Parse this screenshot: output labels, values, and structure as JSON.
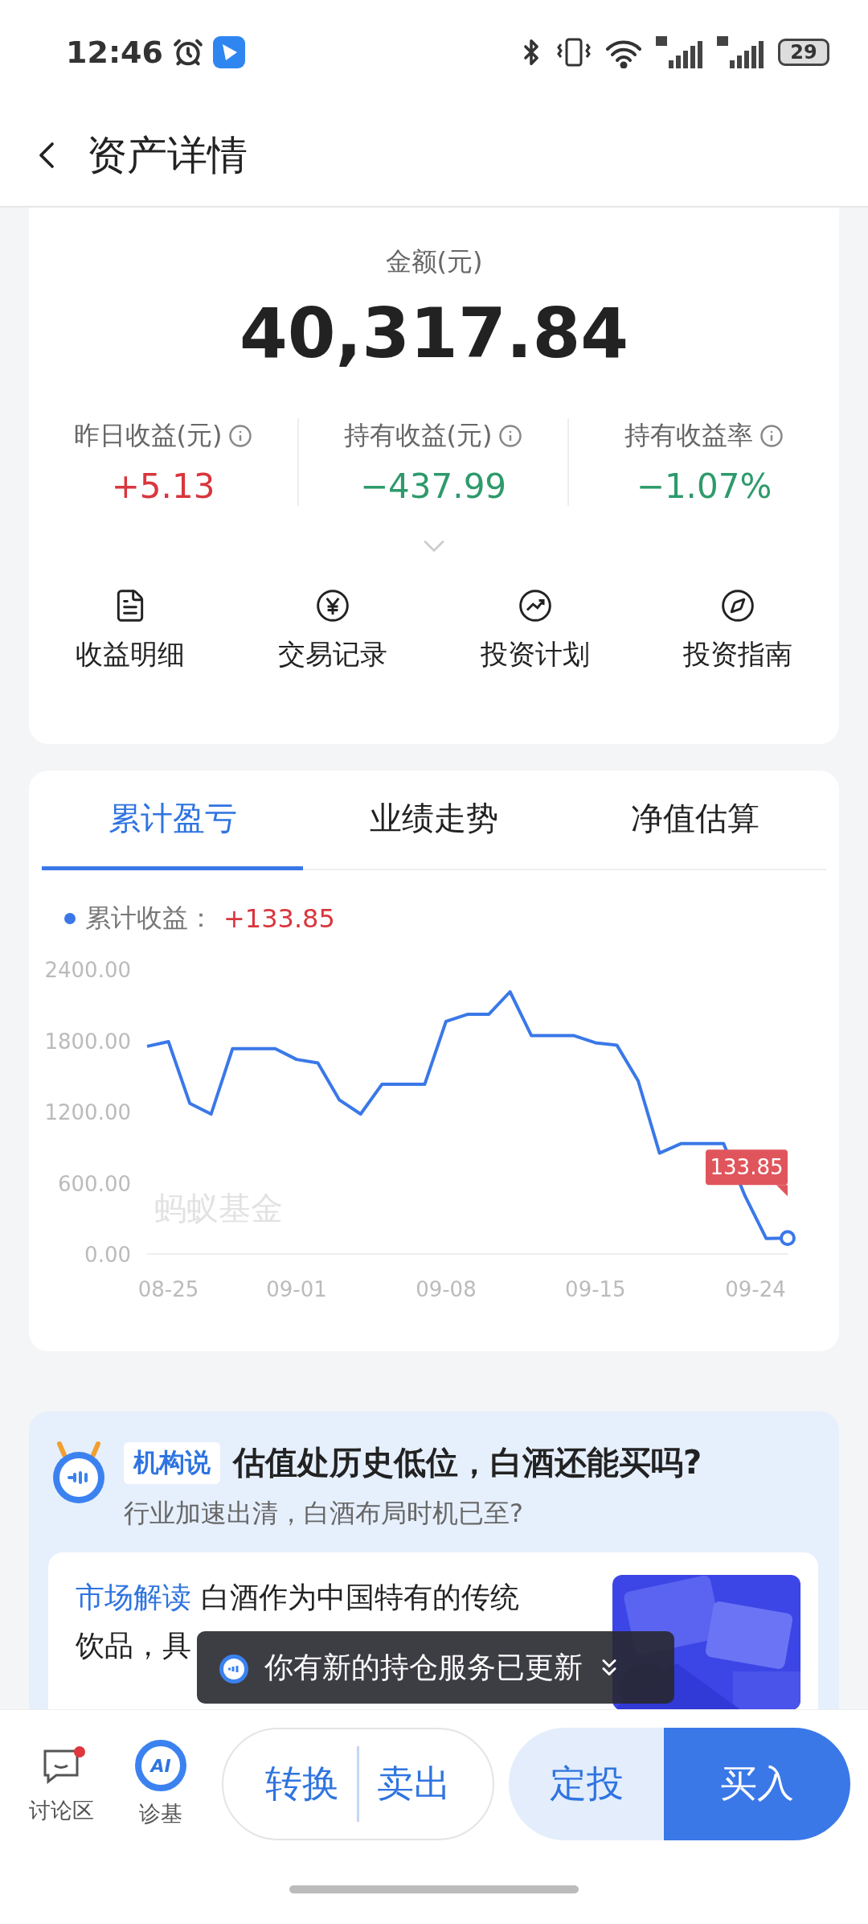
{
  "status_bar": {
    "time": "12:46",
    "battery": "29"
  },
  "header": {
    "title": "资产详情"
  },
  "summary": {
    "amount_label": "金额(元)",
    "amount": "40,317.84",
    "stats": [
      {
        "label": "昨日收益(元)",
        "value": "+5.13",
        "color": "#d9363e"
      },
      {
        "label": "持有收益(元)",
        "value": "−437.99",
        "color": "#2e9a6b"
      },
      {
        "label": "持有收益率",
        "value": "−1.07%",
        "color": "#2e9a6b"
      }
    ],
    "actions": [
      {
        "label": "收益明细",
        "kind": "doc"
      },
      {
        "label": "交易记录",
        "kind": "yen"
      },
      {
        "label": "投资计划",
        "kind": "trend"
      },
      {
        "label": "投资指南",
        "kind": "compass"
      }
    ]
  },
  "chart_card": {
    "tabs": [
      {
        "label": "累计盈亏",
        "selected": true
      },
      {
        "label": "业绩走势",
        "selected": false
      },
      {
        "label": "净值估算",
        "selected": false
      }
    ],
    "legend_suffix": "：",
    "legend_value": "+133.85",
    "watermark": "蚂蚁基金",
    "tooltip": "133.85",
    "chart_data": {
      "type": "line",
      "categories": [
        null,
        "08-25",
        null,
        null,
        null,
        null,
        null,
        "09-01",
        null,
        null,
        null,
        null,
        null,
        null,
        "09-08",
        null,
        null,
        null,
        null,
        null,
        null,
        "09-15",
        null,
        null,
        null,
        null,
        null,
        null,
        null,
        "09-24",
        null
      ],
      "series": [
        {
          "name": "累计收益",
          "color": "#3a78e8",
          "values": [
            1750,
            1790,
            1270,
            1180,
            1730,
            1730,
            1730,
            1640,
            1610,
            1300,
            1180,
            1430,
            1430,
            1430,
            1960,
            2020,
            2020,
            2210,
            1840,
            1840,
            1840,
            1780,
            1760,
            1460,
            850,
            930,
            930,
            930,
            490,
            130,
            134
          ]
        }
      ],
      "ylim": [
        0,
        2400
      ],
      "yticks": [
        {
          "value": 0,
          "label": "0.00"
        },
        {
          "value": 600,
          "label": "600.00"
        },
        {
          "value": 1200,
          "label": "1200.00"
        },
        {
          "value": 1800,
          "label": "1800.00"
        },
        {
          "value": 2400,
          "label": "2400.00"
        }
      ]
    }
  },
  "insight": {
    "tag": "机构说",
    "headline": "估值处历史低位，白酒还能买吗?",
    "subtitle": "行业加速出清，白酒布局时机已至?",
    "article": {
      "category": "市场解读",
      "lines": [
        "白酒作为中国特有的传统",
        "饮品，具"
      ],
      "image": {
        "kind": "picture"
      }
    }
  },
  "toast": {
    "text": "你有新的持仓服务已更新"
  },
  "bottom_bar": {
    "tools": [
      {
        "label": "讨论区",
        "kind": "chat",
        "badge": true
      },
      {
        "label": "诊基",
        "kind": "ai",
        "icon_text": "AI",
        "badge": false
      }
    ],
    "pill_buttons": [
      "转换",
      "卖出"
    ],
    "plan_button": "定投",
    "buy_button": "买入"
  }
}
